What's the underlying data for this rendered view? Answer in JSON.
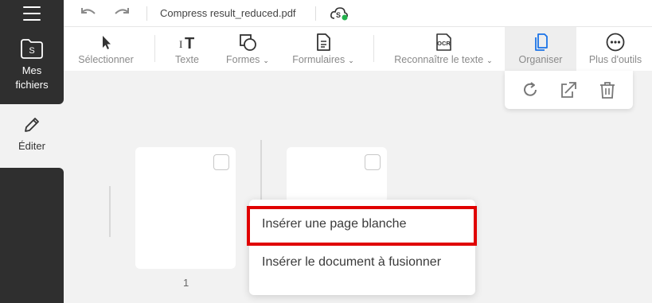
{
  "topbar": {
    "filename": "Compress result_reduced.pdf",
    "undo_icon": "undo-icon",
    "redo_icon": "redo-icon",
    "cloud_icon": "cloud-sync-icon"
  },
  "sidebar": {
    "menu_icon": "hamburger-icon",
    "files_label": "Mes fichiers",
    "edit_label": "Éditer"
  },
  "toolbar": {
    "select": "Sélectionner",
    "text": "Texte",
    "shapes": "Formes",
    "forms": "Formulaires",
    "ocr": "Reconnaître le texte",
    "organize": "Organiser",
    "more": "Plus d'outils"
  },
  "organize_popup": {
    "icons": [
      "rotate-icon",
      "extract-icon",
      "delete-icon"
    ]
  },
  "pages": [
    {
      "number": "1"
    }
  ],
  "context_menu": {
    "items": [
      "Insérer une page blanche",
      "Insérer le document à fusionner"
    ],
    "highlighted": "Insérer une page blanche"
  },
  "colors": {
    "sidebar": "#2f2f2f",
    "active_blue": "#1a73e8",
    "highlight": "#e00000"
  }
}
